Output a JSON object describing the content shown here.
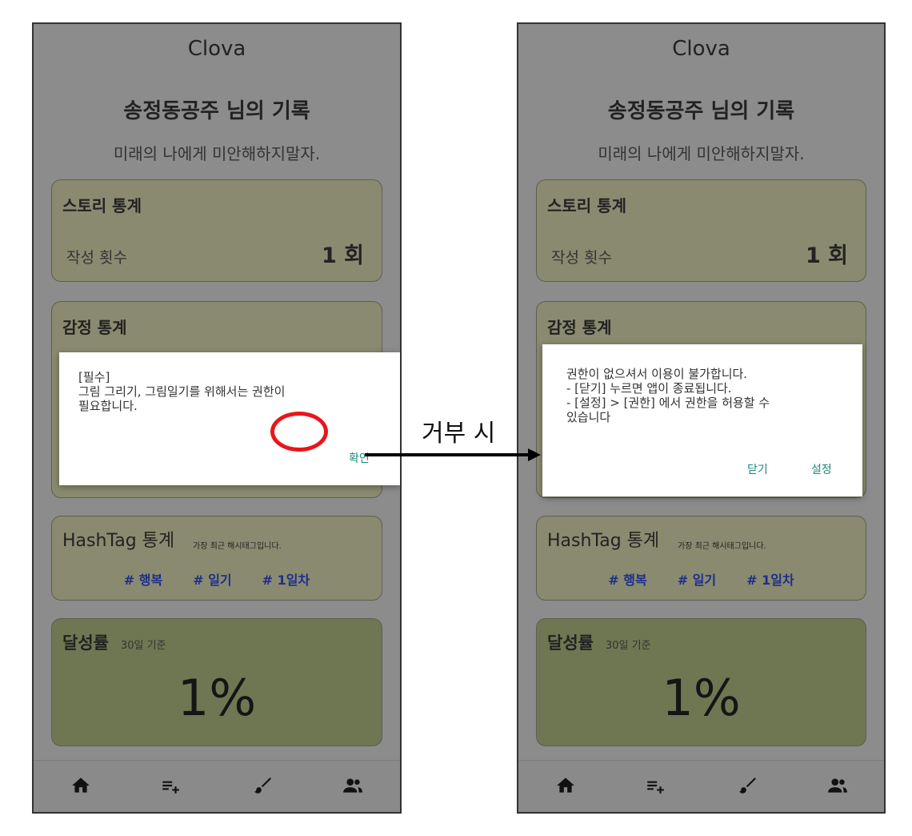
{
  "screens": [
    {
      "app_title": "Clova",
      "record_title": "송정동공주 님의 기록",
      "motto": "미래의 나에게 미안해하지말자.",
      "story": {
        "title": "스토리 통계",
        "label": "작성 횟수",
        "value": "1 회"
      },
      "emotion": {
        "title": "감정 통계"
      },
      "hashtag": {
        "title": "HashTag 통계",
        "note": "가장 최근 해시태그입니다.",
        "tags": [
          "# 행복",
          "# 일기",
          "# 1일차"
        ]
      },
      "achieve": {
        "title": "달성률",
        "basis": "30일 기준",
        "value": "1%"
      },
      "dialog": {
        "text": "[필수]\n그림 그리기, 그림일기를 위해서는 권한이\n필요합니다.",
        "confirm": "확인"
      }
    },
    {
      "app_title": "Clova",
      "record_title": "송정동공주 님의 기록",
      "motto": "미래의 나에게 미안해하지말자.",
      "story": {
        "title": "스토리 통계",
        "label": "작성 횟수",
        "value": "1 회"
      },
      "emotion": {
        "title": "감정 통계"
      },
      "hashtag": {
        "title": "HashTag 통계",
        "note": "가장 최근 해시태그입니다.",
        "tags": [
          "# 행복",
          "# 일기",
          "# 1일차"
        ]
      },
      "achieve": {
        "title": "달성률",
        "basis": "30일 기준",
        "value": "1%"
      },
      "dialog": {
        "text": "권한이 없으셔서 이용이 불가합니다.\n- [닫기] 누르면 앱이 종료됩니다.\n- [설정] > [권한] 에서 권한을 허용할 수\n있습니다",
        "close": "닫기",
        "settings": "설정"
      }
    }
  ],
  "annotation": {
    "label": "거부 시",
    "highlight_color": "#e8161a"
  },
  "nav_icons": [
    "home-icon",
    "add-list-icon",
    "brush-icon",
    "people-icon"
  ]
}
